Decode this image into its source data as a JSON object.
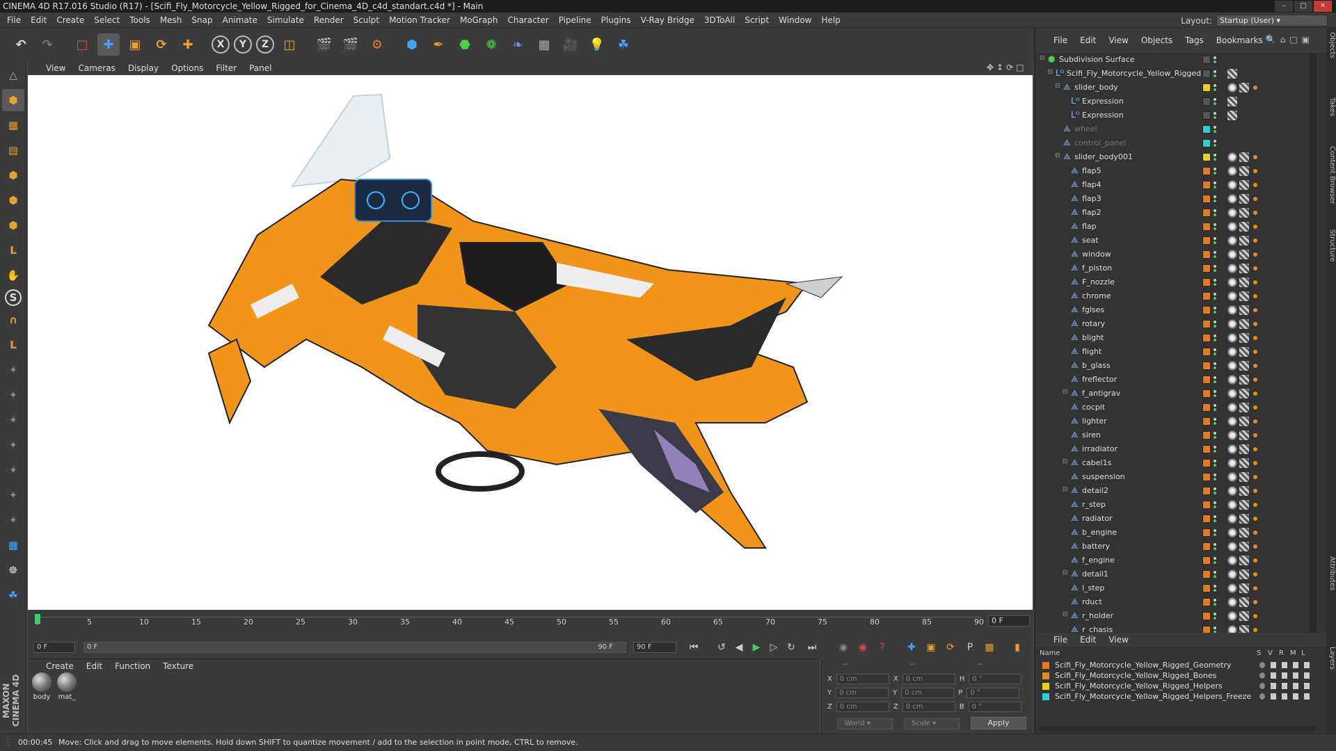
{
  "window": {
    "title": "CINEMA 4D R17.016 Studio (R17) - [Scifi_Fly_Motorcycle_Yellow_Rigged_for_Cinema_4D_c4d_standart.c4d *] - Main"
  },
  "menubar": {
    "items": [
      "File",
      "Edit",
      "Create",
      "Select",
      "Tools",
      "Mesh",
      "Snap",
      "Animate",
      "Simulate",
      "Render",
      "Sculpt",
      "Motion Tracker",
      "MoGraph",
      "Character",
      "Pipeline",
      "Plugins",
      "V-Ray Bridge",
      "3DToAll",
      "Script",
      "Window",
      "Help"
    ]
  },
  "layout": {
    "label": "Layout:",
    "value": "Startup (User)"
  },
  "viewport": {
    "menu": [
      "View",
      "Cameras",
      "Display",
      "Options",
      "Filter",
      "Panel"
    ]
  },
  "timeline": {
    "ticks": [
      "0",
      "5",
      "10",
      "15",
      "20",
      "25",
      "30",
      "35",
      "40",
      "45",
      "50",
      "55",
      "60",
      "65",
      "70",
      "75",
      "80",
      "85",
      "90"
    ],
    "current_frame": "0 F"
  },
  "transport": {
    "start": "0 F",
    "range_start": "0 F",
    "range_end": "90 F",
    "end": "90 F"
  },
  "materials": {
    "menu": [
      "Create",
      "Edit",
      "Function",
      "Texture"
    ],
    "items": [
      "body",
      "mat_"
    ]
  },
  "coordinates": {
    "headers": [
      "--",
      "--",
      "--"
    ],
    "rows": [
      {
        "a": "X",
        "av": "0 cm",
        "b": "X",
        "bv": "0 cm",
        "c": "H",
        "cv": "0 °"
      },
      {
        "a": "Y",
        "av": "0 cm",
        "b": "Y",
        "bv": "0 cm",
        "c": "P",
        "cv": "0 °"
      },
      {
        "a": "Z",
        "av": "0 cm",
        "b": "Z",
        "bv": "0 cm",
        "c": "B",
        "cv": "0 °"
      }
    ],
    "mode1": "World",
    "mode2": "Scale",
    "apply": "Apply"
  },
  "object_manager": {
    "menu": [
      "File",
      "Edit",
      "View",
      "Objects",
      "Tags",
      "Bookmarks"
    ],
    "objects": [
      {
        "name": "Subdivision Surface",
        "indent": 0,
        "color": "",
        "icon": "subdiv"
      },
      {
        "name": "Scifi_Fly_Motorcycle_Yellow_Rigged",
        "indent": 1,
        "color": "",
        "icon": "null"
      },
      {
        "name": "slider_body",
        "indent": 2,
        "color": "#e8d21a",
        "icon": "joint"
      },
      {
        "name": "Expression",
        "indent": 3,
        "color": "",
        "icon": "null"
      },
      {
        "name": "Expression",
        "indent": 3,
        "color": "",
        "icon": "null"
      },
      {
        "name": "wheel",
        "indent": 2,
        "color": "#2ad0d0",
        "icon": "joint",
        "dim": true
      },
      {
        "name": "control_panel",
        "indent": 2,
        "color": "#2ad0d0",
        "icon": "joint",
        "dim": true
      },
      {
        "name": "slider_body001",
        "indent": 2,
        "color": "#e8d21a",
        "icon": "joint"
      },
      {
        "name": "flap5",
        "indent": 3,
        "color": "#e87a1a",
        "icon": "joint"
      },
      {
        "name": "flap4",
        "indent": 3,
        "color": "#e87a1a",
        "icon": "joint"
      },
      {
        "name": "flap3",
        "indent": 3,
        "color": "#e87a1a",
        "icon": "joint"
      },
      {
        "name": "flap2",
        "indent": 3,
        "color": "#e87a1a",
        "icon": "joint"
      },
      {
        "name": "flap",
        "indent": 3,
        "color": "#e87a1a",
        "icon": "joint"
      },
      {
        "name": "seat",
        "indent": 3,
        "color": "#e87a1a",
        "icon": "joint"
      },
      {
        "name": "window",
        "indent": 3,
        "color": "#e87a1a",
        "icon": "joint"
      },
      {
        "name": "f_piston",
        "indent": 3,
        "color": "#e87a1a",
        "icon": "joint"
      },
      {
        "name": "F_nozzle",
        "indent": 3,
        "color": "#e87a1a",
        "icon": "joint"
      },
      {
        "name": "chrome",
        "indent": 3,
        "color": "#e87a1a",
        "icon": "joint"
      },
      {
        "name": "fglses",
        "indent": 3,
        "color": "#e87a1a",
        "icon": "joint"
      },
      {
        "name": "rotary",
        "indent": 3,
        "color": "#e87a1a",
        "icon": "joint"
      },
      {
        "name": "blight",
        "indent": 3,
        "color": "#e87a1a",
        "icon": "joint"
      },
      {
        "name": "flight",
        "indent": 3,
        "color": "#e87a1a",
        "icon": "joint"
      },
      {
        "name": "b_glass",
        "indent": 3,
        "color": "#e87a1a",
        "icon": "joint"
      },
      {
        "name": "freflector",
        "indent": 3,
        "color": "#e87a1a",
        "icon": "joint"
      },
      {
        "name": "f_antigrav",
        "indent": 3,
        "color": "#e87a1a",
        "icon": "joint"
      },
      {
        "name": "cocpit",
        "indent": 3,
        "color": "#e87a1a",
        "icon": "joint"
      },
      {
        "name": "lighter",
        "indent": 3,
        "color": "#e87a1a",
        "icon": "joint"
      },
      {
        "name": "siren",
        "indent": 3,
        "color": "#e87a1a",
        "icon": "joint"
      },
      {
        "name": "irradiator",
        "indent": 3,
        "color": "#e87a1a",
        "icon": "joint"
      },
      {
        "name": "cabel1s",
        "indent": 3,
        "color": "#e87a1a",
        "icon": "joint"
      },
      {
        "name": "suspension",
        "indent": 3,
        "color": "#e87a1a",
        "icon": "joint"
      },
      {
        "name": "detail2",
        "indent": 3,
        "color": "#e87a1a",
        "icon": "joint"
      },
      {
        "name": "r_step",
        "indent": 3,
        "color": "#e87a1a",
        "icon": "joint"
      },
      {
        "name": "radiator",
        "indent": 3,
        "color": "#e87a1a",
        "icon": "joint"
      },
      {
        "name": "b_engine",
        "indent": 3,
        "color": "#e87a1a",
        "icon": "joint"
      },
      {
        "name": "battery",
        "indent": 3,
        "color": "#e87a1a",
        "icon": "joint"
      },
      {
        "name": "f_engine",
        "indent": 3,
        "color": "#e87a1a",
        "icon": "joint"
      },
      {
        "name": "detail1",
        "indent": 3,
        "color": "#e87a1a",
        "icon": "joint"
      },
      {
        "name": "l_step",
        "indent": 3,
        "color": "#e87a1a",
        "icon": "joint"
      },
      {
        "name": "rduct",
        "indent": 3,
        "color": "#e87a1a",
        "icon": "joint"
      },
      {
        "name": "r_holder",
        "indent": 3,
        "color": "#e87a1a",
        "icon": "joint"
      },
      {
        "name": "r_chasis",
        "indent": 3,
        "color": "#e87a1a",
        "icon": "joint"
      }
    ]
  },
  "layers": {
    "menu": [
      "File",
      "Edit",
      "View"
    ],
    "headers": {
      "name": "Name",
      "cols": [
        "S",
        "V",
        "R",
        "M",
        "L"
      ]
    },
    "items": [
      {
        "name": "Scifi_Fly_Motorcycle_Yellow_Rigged_Geometry",
        "color": "#e87a1a"
      },
      {
        "name": "Scifi_Fly_Motorcycle_Yellow_Rigged_Bones",
        "color": "#e8871a"
      },
      {
        "name": "Scifi_Fly_Motorcycle_Yellow_Rigged_Helpers",
        "color": "#e8d21a"
      },
      {
        "name": "Scifi_Fly_Motorcycle_Yellow_Rigged_Helpers_Freeze",
        "color": "#2ad0d0"
      }
    ]
  },
  "side_tabs": [
    "Objects",
    "Takes",
    "Content Browser",
    "Structure",
    "Attributes",
    "Layers"
  ],
  "status": {
    "time": "00:00:45",
    "message": "Move: Click and drag to move elements. Hold down SHIFT to quantize movement / add to the selection in point mode, CTRL to remove."
  },
  "branding": {
    "maxon": "MAXON CINEMA 4D"
  }
}
